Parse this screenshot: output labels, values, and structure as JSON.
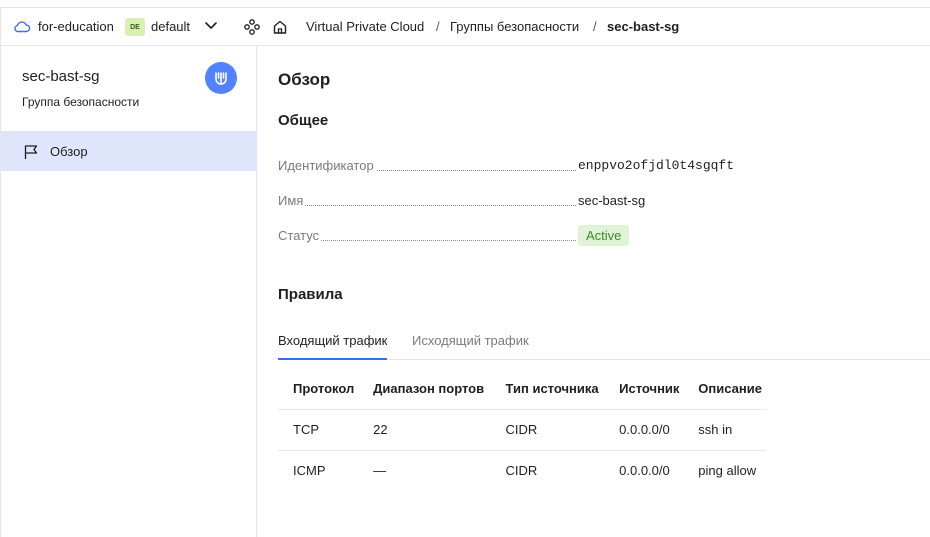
{
  "topbar": {
    "cloud": "for-education",
    "folder_badge": "DE",
    "folder": "default",
    "breadcrumbs": [
      "Virtual Private Cloud",
      "Группы безопасности",
      "sec-bast-sg"
    ],
    "separator": "/"
  },
  "sidebar": {
    "title": "sec-bast-sg",
    "subtitle": "Группа безопасности",
    "service_icon": "vpc-icon",
    "items": [
      {
        "label": "Обзор",
        "icon": "flag-icon",
        "active": true
      }
    ]
  },
  "main": {
    "page_title": "Обзор",
    "general": {
      "title": "Общее",
      "properties": [
        {
          "label": "Идентификатор",
          "value": "enppvo2ofjdl0t4sgqft"
        },
        {
          "label": "Имя",
          "value": "sec-bast-sg"
        },
        {
          "label": "Статус",
          "value": "Active"
        }
      ]
    },
    "rules": {
      "title": "Правила",
      "tabs": [
        {
          "label": "Входящий трафик",
          "active": true
        },
        {
          "label": "Исходящий трафик",
          "active": false
        }
      ],
      "columns": [
        "Протокол",
        "Диапазон портов",
        "Тип источника",
        "Источник",
        "Описание"
      ],
      "rows": [
        [
          "TCP",
          "22",
          "CIDR",
          "0.0.0.0/0",
          "ssh in"
        ],
        [
          "ICMP",
          "—",
          "CIDR",
          "0.0.0.0/0",
          "ping allow"
        ]
      ]
    }
  },
  "colors": {
    "accent": "#3a6df0",
    "service_icon_bg": "#5282ff",
    "sidebar_active_bg": "#dfe6fb",
    "status_bg": "#dff3d6",
    "status_text": "#3e8a2a",
    "folder_badge_bg": "#d8f0b0"
  }
}
